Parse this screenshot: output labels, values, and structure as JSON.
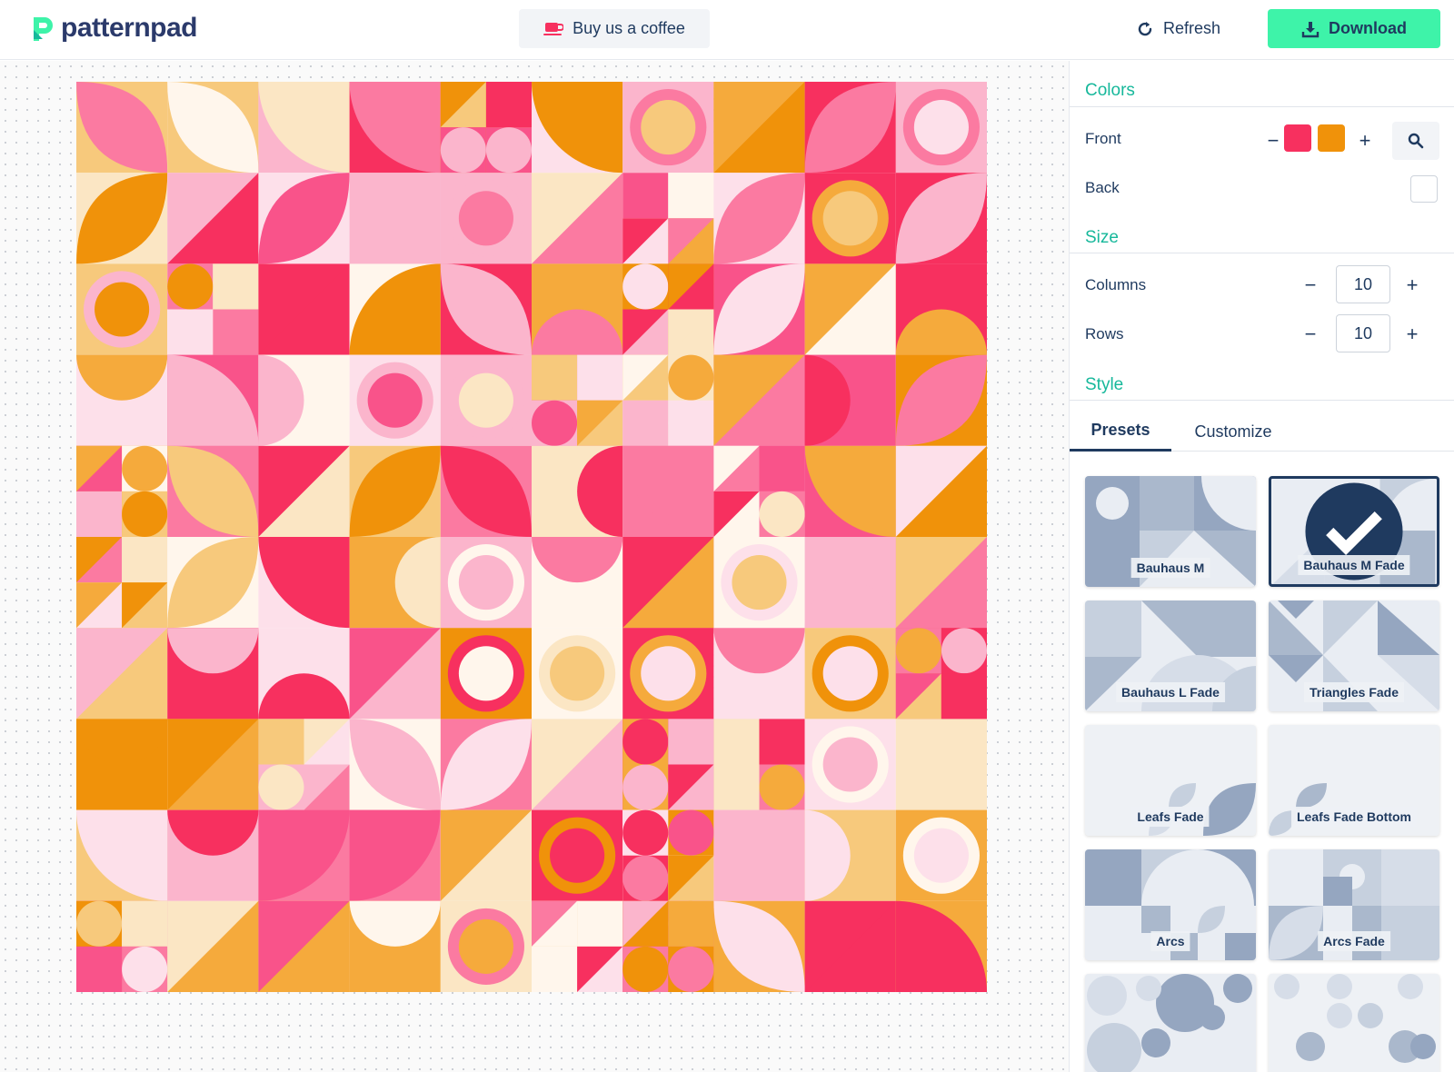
{
  "app": {
    "logo_text": "patternpad",
    "coffee_label": "Buy us a coffee",
    "refresh_label": "Refresh",
    "download_label": "Download"
  },
  "colors": {
    "accent": "#3ef3a9",
    "section_title": "#17b89b",
    "front_swatches": [
      "#f7305f",
      "#f0920a"
    ],
    "back_swatch": "#ffffff"
  },
  "sidebar": {
    "colors_title": "Colors",
    "front_label": "Front",
    "back_label": "Back",
    "size_title": "Size",
    "columns_label": "Columns",
    "columns_value": "10",
    "rows_label": "Rows",
    "rows_value": "10",
    "style_title": "Style",
    "minus": "−",
    "plus": "+"
  },
  "tabs": [
    {
      "label": "Presets",
      "active": true
    },
    {
      "label": "Customize",
      "active": false
    }
  ],
  "presets": [
    {
      "label": "Bauhaus M",
      "selected": false
    },
    {
      "label": "Bauhaus M Fade",
      "selected": true
    },
    {
      "label": "Bauhaus L Fade",
      "selected": false
    },
    {
      "label": "Triangles Fade",
      "selected": false
    },
    {
      "label": "Leafs Fade",
      "selected": false
    },
    {
      "label": "Leafs Fade Bottom",
      "selected": false
    },
    {
      "label": "Arcs",
      "selected": false
    },
    {
      "label": "Arcs Fade",
      "selected": false
    },
    {
      "label": "",
      "selected": false
    },
    {
      "label": "",
      "selected": false
    }
  ]
}
